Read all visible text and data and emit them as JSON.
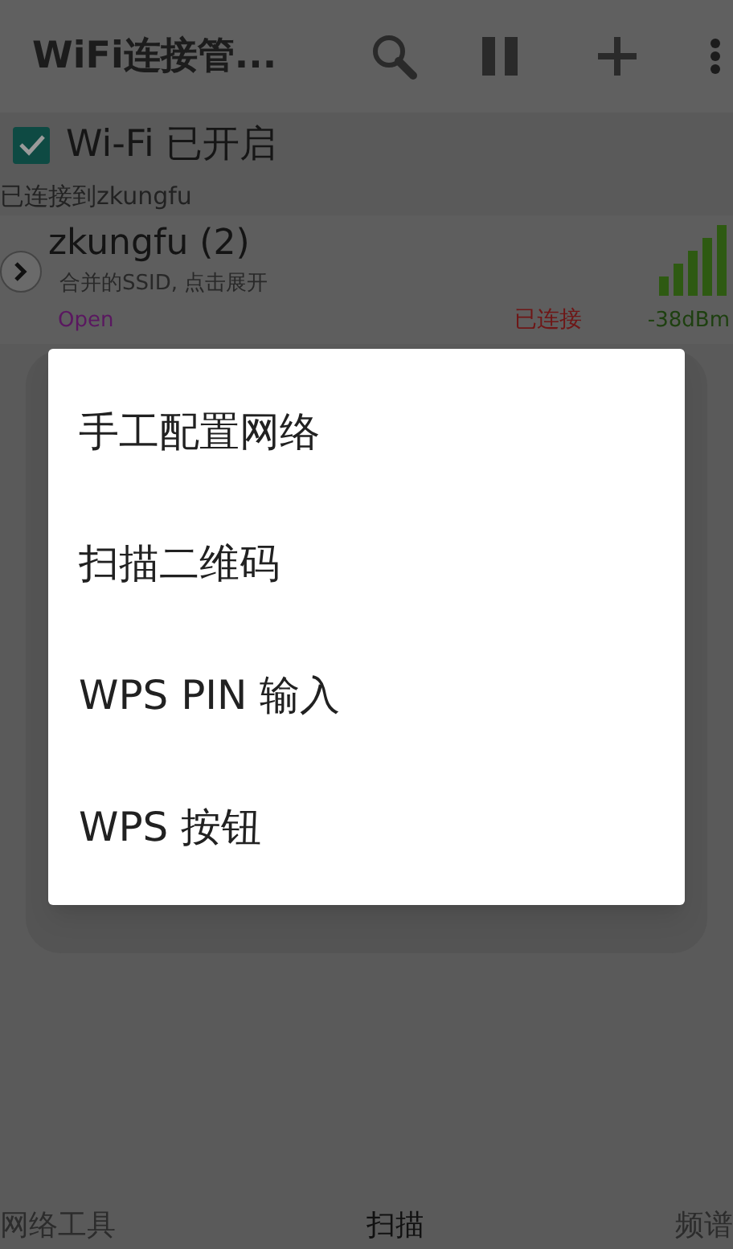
{
  "app_bar": {
    "title": "WiFi连接管..."
  },
  "wifi_toggle": {
    "label": "Wi-Fi 已开启",
    "checked": true
  },
  "connection_status": "已连接到zkungfu",
  "networks": [
    {
      "name": "zkungfu (2)",
      "subtitle": "合并的SSID, 点击展开",
      "security": "Open",
      "status": "已连接",
      "signal": "-38dBm"
    }
  ],
  "menu": {
    "items": [
      "手工配置网络",
      "扫描二维码",
      "WPS PIN 输入",
      "WPS 按钮"
    ]
  },
  "tabs": [
    {
      "label": "网络工具",
      "selected": false
    },
    {
      "label": "扫描",
      "selected": true
    },
    {
      "label": "频谱",
      "selected": false
    }
  ]
}
